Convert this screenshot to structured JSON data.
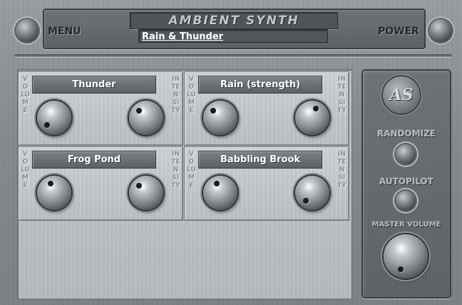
{
  "header": {
    "app_title": "AMBIENT SYNTH",
    "preset_name": "Rain & Thunder",
    "menu_label": "MENU",
    "power_label": "POWER"
  },
  "channels": [
    {
      "name": "Thunder",
      "volume_label": "VOLUME",
      "intensity_label": "INTENSITY",
      "volume_knob_angle_deg": 225,
      "intensity_knob_angle_deg": 315
    },
    {
      "name": "Rain (strength)",
      "volume_label": "VOLUME",
      "intensity_label": "INTENSITY",
      "volume_knob_angle_deg": 315,
      "intensity_knob_angle_deg": 20
    },
    {
      "name": "Frog Pond",
      "volume_label": "VOLUME",
      "intensity_label": "INTENSITY",
      "volume_knob_angle_deg": 340,
      "intensity_knob_angle_deg": 315
    },
    {
      "name": "Babbling Brook",
      "volume_label": "VOLUME",
      "intensity_label": "INTENSITY",
      "volume_knob_angle_deg": 340,
      "intensity_knob_angle_deg": 220
    }
  ],
  "side_panel": {
    "logo_text": "AS",
    "randomize_label": "RANDOMIZE",
    "autopilot_label": "AUTOPILOT",
    "master_volume_label": "MASTER VOLUME"
  }
}
